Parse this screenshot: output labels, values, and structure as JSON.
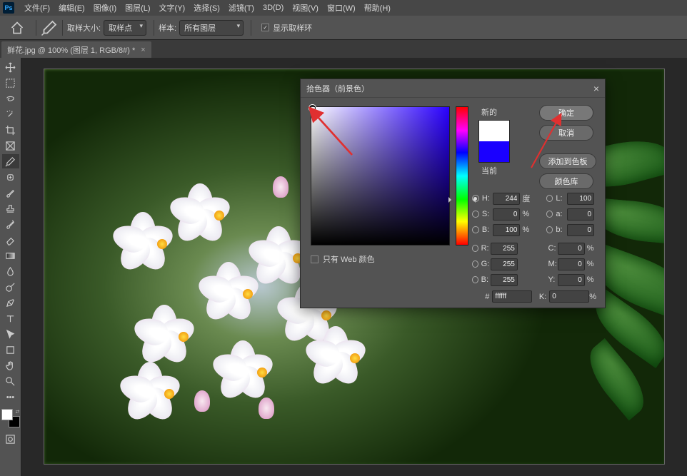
{
  "app": {
    "logo": "Ps"
  },
  "menubar": {
    "items": [
      "文件(F)",
      "编辑(E)",
      "图像(I)",
      "图层(L)",
      "文字(Y)",
      "选择(S)",
      "滤镜(T)",
      "3D(D)",
      "视图(V)",
      "窗口(W)",
      "帮助(H)"
    ]
  },
  "optionsbar": {
    "sample_size_label": "取样大小:",
    "sample_size_value": "取样点",
    "sample_label": "样本:",
    "sample_value": "所有图层",
    "show_ring_label": "显示取样环"
  },
  "document": {
    "tab_title": "鲜花.jpg @ 100% (图层 1, RGB/8#) *"
  },
  "colorpicker": {
    "title": "拾色器（前景色）",
    "ok": "确定",
    "cancel": "取消",
    "add_swatch": "添加到色板",
    "libraries": "颜色库",
    "new_label": "新的",
    "current_label": "当前",
    "web_only": "只有 Web 颜色",
    "H": {
      "label": "H:",
      "value": "244",
      "unit": "度"
    },
    "S": {
      "label": "S:",
      "value": "0",
      "unit": "%"
    },
    "Bv": {
      "label": "B:",
      "value": "100",
      "unit": "%"
    },
    "R": {
      "label": "R:",
      "value": "255"
    },
    "G": {
      "label": "G:",
      "value": "255"
    },
    "B": {
      "label": "B:",
      "value": "255"
    },
    "L": {
      "label": "L:",
      "value": "100"
    },
    "a": {
      "label": "a:",
      "value": "0"
    },
    "b": {
      "label": "b:",
      "value": "0"
    },
    "C": {
      "label": "C:",
      "value": "0",
      "unit": "%"
    },
    "M": {
      "label": "M:",
      "value": "0",
      "unit": "%"
    },
    "Y": {
      "label": "Y:",
      "value": "0",
      "unit": "%"
    },
    "K": {
      "label": "K:",
      "value": "0",
      "unit": "%"
    },
    "hex_label": "#",
    "hex_value": "ffffff"
  }
}
